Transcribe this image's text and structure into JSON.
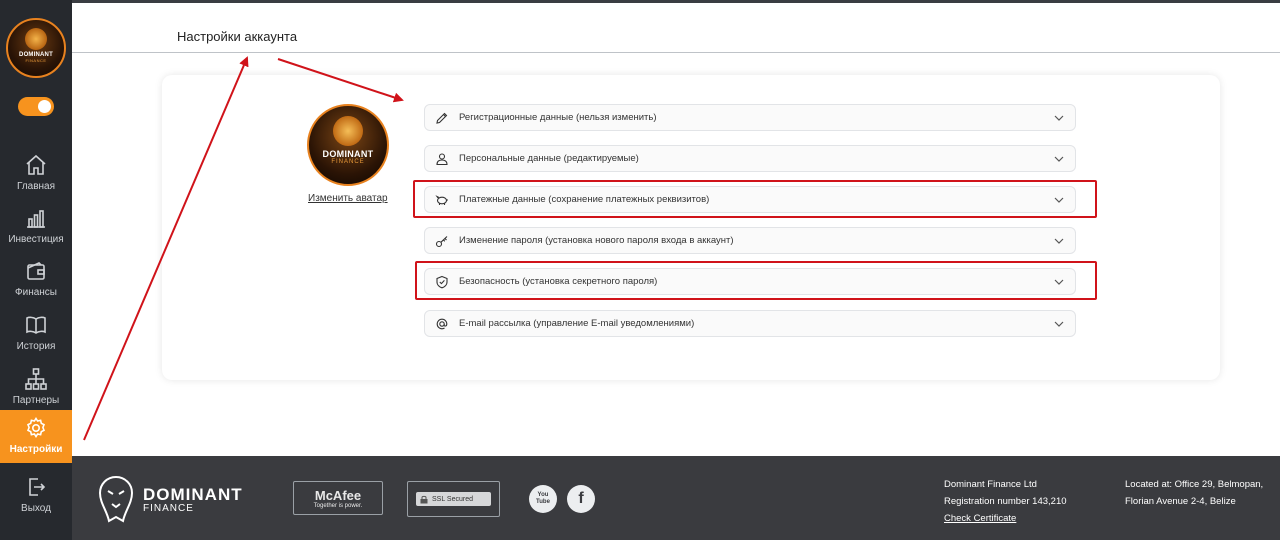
{
  "sidebar": {
    "logo": {
      "line1": "DOMINANT",
      "line2": "FINANCE"
    },
    "items": [
      {
        "label": "Главная",
        "icon": "home-icon"
      },
      {
        "label": "Инвестиция",
        "icon": "bar-chart-icon"
      },
      {
        "label": "Финансы",
        "icon": "wallet-icon"
      },
      {
        "label": "История",
        "icon": "book-icon"
      },
      {
        "label": "Партнеры",
        "icon": "network-icon"
      },
      {
        "label": "Настройки",
        "icon": "gear-icon",
        "active": true
      },
      {
        "label": "Выход",
        "icon": "logout-icon"
      }
    ],
    "accent_color": "#f7931e"
  },
  "header": {
    "title": "Настройки аккаунта"
  },
  "profile": {
    "avatar": {
      "line1": "DOMINANT",
      "line2": "FINANCE"
    },
    "change_avatar_label": "Изменить аватар"
  },
  "sections": [
    {
      "label": "Регистрационные данные (нельзя изменить)",
      "icon": "pencil-icon"
    },
    {
      "label": "Персональные данные (редактируемые)",
      "icon": "user-icon"
    },
    {
      "label": "Платежные данные (сохранение платежных реквизитов)",
      "icon": "piggy-bank-icon"
    },
    {
      "label": "Изменение пароля (установка нового пароля входа в аккаунт)",
      "icon": "key-icon"
    },
    {
      "label": "Безопасность (установка секретного пароля)",
      "icon": "shield-icon"
    },
    {
      "label": "E-mail рассылка (управление E-mail уведомлениями)",
      "icon": "at-icon"
    }
  ],
  "footer": {
    "brand": {
      "line1": "DOMINANT",
      "line2": "FINANCE"
    },
    "mcafee": {
      "name": "McAfee",
      "tagline": "Together is power."
    },
    "ssl_label": "SSL Secured",
    "social": [
      {
        "label": "You Tube",
        "icon": "youtube-icon"
      },
      {
        "label": "f",
        "icon": "facebook-icon"
      }
    ],
    "company": {
      "name": "Dominant Finance Ltd",
      "registration": "Registration number 143,210",
      "certificate_link": "Check Certificate"
    },
    "location": {
      "line1": "Located at: Office 29, Belmopan,",
      "line2": "Florian Avenue 2-4, Belize"
    }
  },
  "colors": {
    "sidebar_bg": "#26292e",
    "footer_bg": "#3a3b3f",
    "highlight": "#d0131a",
    "accent": "#f7931e"
  }
}
